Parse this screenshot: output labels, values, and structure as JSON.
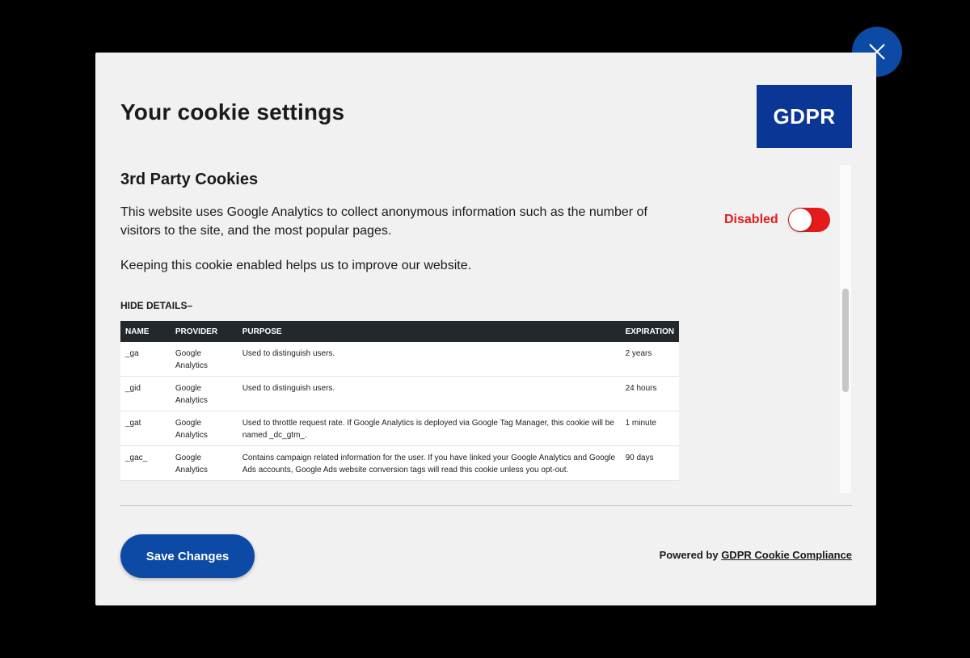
{
  "modal": {
    "title": "Your cookie settings",
    "logo_text": "GDPR",
    "close_icon": "close-icon"
  },
  "section": {
    "title": "3rd Party Cookies",
    "description": "This website uses Google Analytics to collect anonymous information such as the number of visitors to the site, and the most popular pages.",
    "description2": "Keeping this cookie enabled helps us to improve our website.",
    "toggle_label": "Disabled",
    "toggle_state": "off",
    "hide_details": "HIDE DETAILS–"
  },
  "table": {
    "headers": [
      "NAME",
      "PROVIDER",
      "PURPOSE",
      "EXPIRATION"
    ],
    "rows": [
      {
        "name": "_ga",
        "provider": "Google Analytics",
        "purpose": "Used to distinguish users.",
        "expiration": "2 years"
      },
      {
        "name": "_gid",
        "provider": "Google Analytics",
        "purpose": "Used to distinguish users.",
        "expiration": "24 hours"
      },
      {
        "name": "_gat",
        "provider": "Google Analytics",
        "purpose": "Used to throttle request rate. If Google Analytics is deployed via Google Tag Manager, this cookie will be named _dc_gtm_.",
        "expiration": "1 minute"
      },
      {
        "name": "_gac_",
        "provider": "Google Analytics",
        "purpose": "Contains campaign related information for the user. If you have linked your Google Analytics and Google Ads accounts, Google Ads website conversion tags will read this cookie unless you opt-out.",
        "expiration": "90 days"
      }
    ]
  },
  "footer": {
    "save_label": "Save Changes",
    "powered_prefix": "Powered by",
    "powered_link": "GDPR Cookie Compliance"
  },
  "colors": {
    "accent": "#0d4aa6",
    "logo_bg": "#0a3696",
    "toggle_off": "#e31b1b"
  }
}
